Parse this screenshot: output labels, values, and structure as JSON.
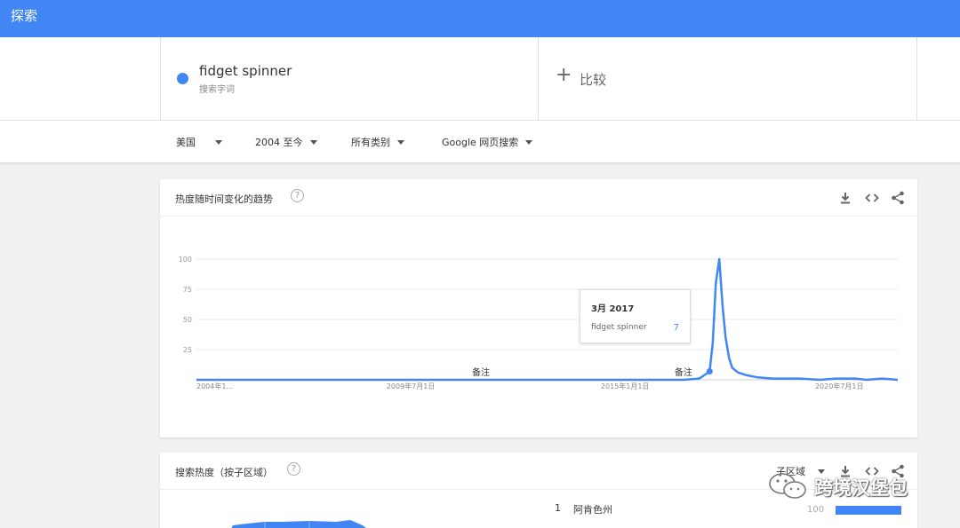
{
  "header": {
    "title": "探索"
  },
  "term": {
    "name": "fidget spinner",
    "type_label": "搜索字词",
    "color": "#4285f4"
  },
  "compare": {
    "plus": "+",
    "label": "比较"
  },
  "filters": [
    {
      "label": "美国"
    },
    {
      "label": "2004 至今"
    },
    {
      "label": "所有类别"
    },
    {
      "label": "Google 网页搜索"
    }
  ],
  "interest_card": {
    "title": "热度随时间变化的趋势",
    "help": "?"
  },
  "tooltip": {
    "date": "3月 2017",
    "term": "fidget spinner",
    "value": "7"
  },
  "chart_data": {
    "type": "line",
    "title": "",
    "xlabel": "",
    "ylabel": "",
    "ylim": [
      0,
      100
    ],
    "yticks": [
      "100",
      "75",
      "50",
      "25"
    ],
    "xticks": [
      {
        "label": "2004年1...",
        "year": 2004.0
      },
      {
        "label": "2009年7月1日",
        "year": 2009.5
      },
      {
        "label": "2015年1月1日",
        "year": 2015.0
      },
      {
        "label": "2020年7月1日",
        "year": 2020.5
      }
    ],
    "xlim": [
      2004.0,
      2022.0
    ],
    "annotations": [
      {
        "label": "备注",
        "year": 2011.3
      },
      {
        "label": "备注",
        "year": 2016.5
      }
    ],
    "highlight": {
      "year": 2017.17,
      "value": 7
    },
    "grid": true,
    "series": [
      {
        "color": "#4285f4",
        "points": [
          [
            2004.0,
            0
          ],
          [
            2016.5,
            0
          ],
          [
            2016.9,
            1
          ],
          [
            2017.0,
            3
          ],
          [
            2017.17,
            7
          ],
          [
            2017.25,
            30
          ],
          [
            2017.33,
            80
          ],
          [
            2017.42,
            100
          ],
          [
            2017.5,
            62
          ],
          [
            2017.58,
            35
          ],
          [
            2017.67,
            18
          ],
          [
            2017.75,
            10
          ],
          [
            2017.9,
            6
          ],
          [
            2018.1,
            4
          ],
          [
            2018.4,
            2
          ],
          [
            2018.8,
            1
          ],
          [
            2019.5,
            1
          ],
          [
            2020.0,
            0
          ],
          [
            2020.4,
            1
          ],
          [
            2020.9,
            1
          ],
          [
            2021.2,
            0
          ],
          [
            2021.6,
            1
          ],
          [
            2022.0,
            0
          ]
        ]
      }
    ]
  },
  "region_card": {
    "title": "搜索热度（按子区域）",
    "help": "?",
    "dropdown": "子区域"
  },
  "regions": [
    {
      "rank": "1",
      "name": "阿肯色州",
      "value": 100
    }
  ],
  "watermark": {
    "text": "跨境汉堡包",
    "icon": "wechat-icon"
  }
}
